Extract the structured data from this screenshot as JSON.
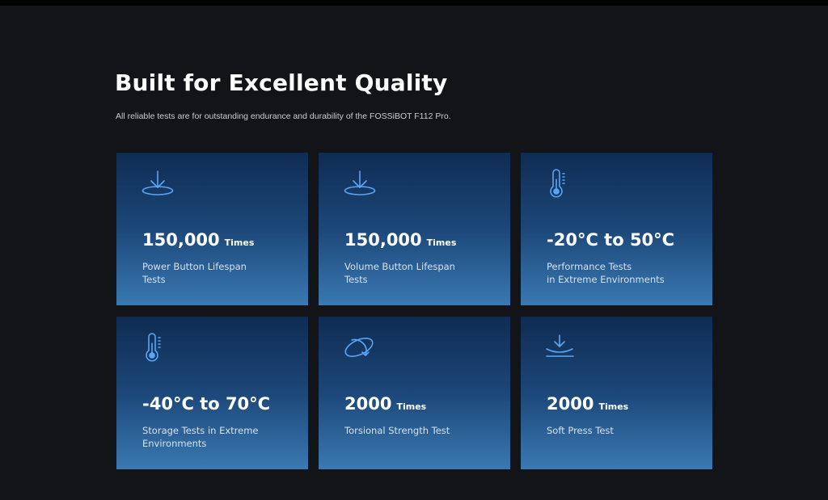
{
  "heading": {
    "title": "Built for Excellent Quality",
    "subtitle": "All reliable tests are for outstanding endurance and durability of the FOSSiBOT F112 Pro."
  },
  "colors": {
    "background": "#131418",
    "card_top": "#0f2c53",
    "card_bottom": "#3a79b2",
    "icon": "#5aa6f5"
  },
  "cards": [
    {
      "icon": "press-down-icon",
      "value": "150,000",
      "unit": "Times",
      "description": "Power Button Lifespan\nTests"
    },
    {
      "icon": "press-down-icon",
      "value": "150,000",
      "unit": "Times",
      "description": "Volume Button Lifespan\nTests"
    },
    {
      "icon": "thermometer-icon",
      "value": "-20°C to 50°C",
      "unit": "",
      "description": "Performance Tests\nin Extreme Environments"
    },
    {
      "icon": "thermometer-icon",
      "value": "-40°C to 70°C",
      "unit": "",
      "description": "Storage Tests in Extreme\nEnvironments"
    },
    {
      "icon": "torsion-icon",
      "value": "2000",
      "unit": "Times",
      "description": "Torsional Strength Test"
    },
    {
      "icon": "soft-press-icon",
      "value": "2000",
      "unit": "Times",
      "description": "Soft Press Test"
    }
  ]
}
